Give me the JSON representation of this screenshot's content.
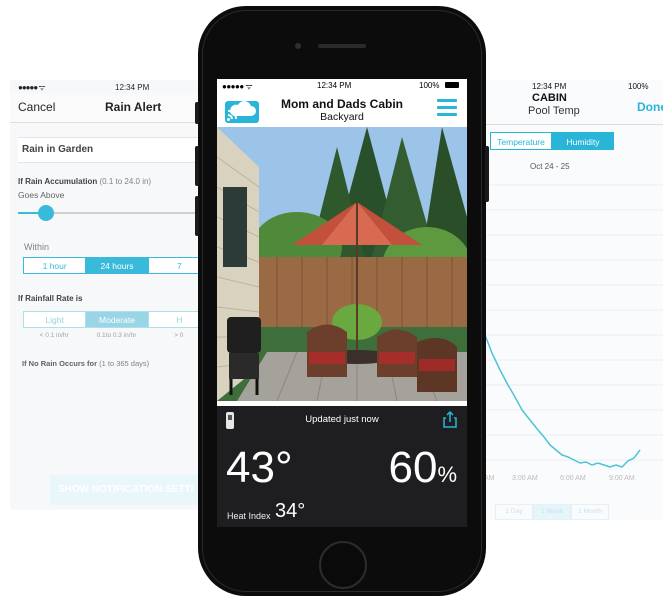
{
  "left_screen": {
    "time": "12:34 PM",
    "signal": "●●●●● ᯤ",
    "cancel": "Cancel",
    "title": "Rain Alert",
    "field": "Rain in Garden",
    "accum_label": "If Rain Accumulation",
    "accum_hint": "(0.1 to 24.0 in)",
    "goes_above": "Goes Above",
    "slider_fraction": 0.12,
    "within": "Within",
    "within_options": [
      "1 hour",
      "24 hours",
      "7"
    ],
    "within_selected": "24 hours",
    "rate_label": "If Rainfall Rate is",
    "rate_options": [
      "Light",
      "Moderate",
      "H"
    ],
    "rate_selected": "Moderate",
    "rate_hints": [
      "< 0.1 in/hr",
      "0.1to 0.3  in/hr",
      "> 0"
    ],
    "norain_label": "If No Rain Occurs for",
    "norain_hint": "(1 to 365 days)",
    "notif_button": "SHOW NOTIFICATION SETTI"
  },
  "right_screen": {
    "time": "12:34 PM",
    "battery": "100%",
    "title": "CABIN",
    "subtitle": "Pool Temp",
    "done": "Done",
    "tabs": [
      "Temperature",
      "Humidity"
    ],
    "selected_tab": "Humidity",
    "date_range": "Oct 24 - 25",
    "x_labels": [
      "AM",
      "3:00 AM",
      "6:00 AM",
      "9:00 AM"
    ],
    "ranges": [
      "1 Day",
      "1 Week",
      "1 Month"
    ],
    "line_color": "#4cc3d6"
  },
  "main": {
    "status": {
      "signal": "●●●●● ᯤ",
      "time": "12:34 PM",
      "battery": "100%"
    },
    "title": "Mom and Dads Cabin",
    "subtitle": "Backyard",
    "updated": "Updated just now",
    "temperature": "43°",
    "humidity": "60",
    "humidity_unit": "%",
    "heat_index_label": "Heat Index",
    "heat_index_value": "34°",
    "accent": "#29b5d8"
  }
}
